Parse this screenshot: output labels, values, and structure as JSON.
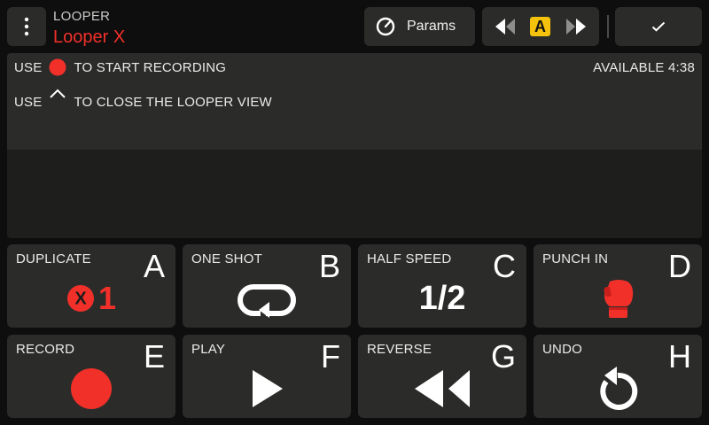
{
  "header": {
    "subtitle": "LOOPER",
    "title": "Looper X",
    "params_label": "Params",
    "ab_label": "A",
    "menu_icon": "kebab-menu-icon",
    "confirm_icon": "checkmark-icon"
  },
  "info": {
    "line1_prefix": "USE",
    "line1_suffix": "TO START RECORDING",
    "line2_prefix": "USE",
    "line2_suffix": "TO CLOSE THE LOOPER VIEW",
    "available": "AVAILABLE 4:38"
  },
  "pads": [
    {
      "label": "DUPLICATE",
      "key": "A",
      "value": "1",
      "icon": "duplicate-x-icon"
    },
    {
      "label": "ONE SHOT",
      "key": "B",
      "icon": "loop-icon"
    },
    {
      "label": "HALF SPEED",
      "key": "C",
      "value": "1/2"
    },
    {
      "label": "PUNCH IN",
      "key": "D",
      "icon": "boxing-glove-icon"
    },
    {
      "label": "RECORD",
      "key": "E",
      "icon": "record-icon"
    },
    {
      "label": "PLAY",
      "key": "F",
      "icon": "play-icon"
    },
    {
      "label": "REVERSE",
      "key": "G",
      "icon": "rewind-icon"
    },
    {
      "label": "UNDO",
      "key": "H",
      "icon": "undo-icon"
    }
  ],
  "colors": {
    "accent_red": "#f2302a",
    "ab_yellow": "#f4c20d",
    "panel": "#2b2c2a",
    "background": "#0d0e0d"
  }
}
